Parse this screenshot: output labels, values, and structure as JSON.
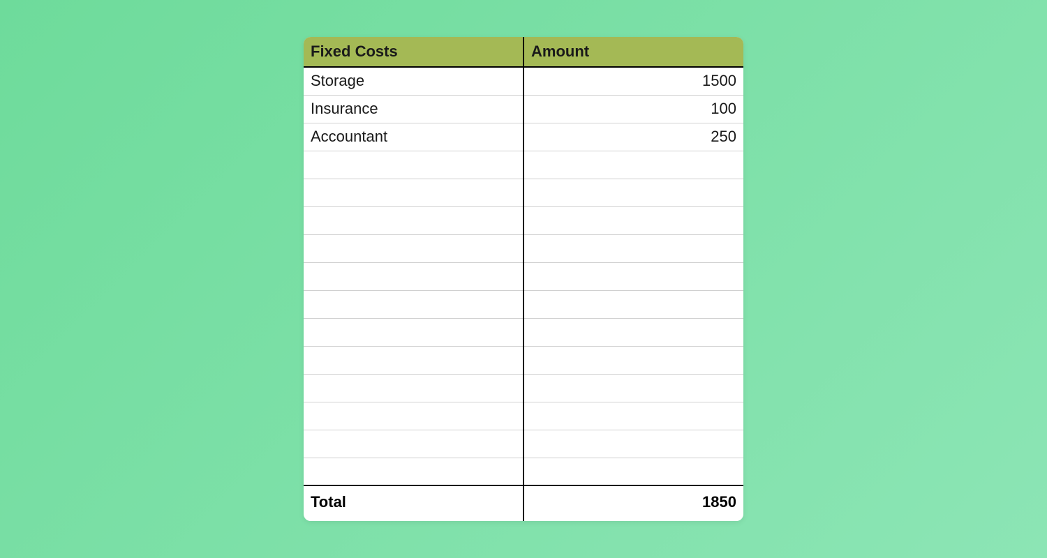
{
  "chart_data": {
    "type": "table",
    "title": "Fixed Costs",
    "columns": [
      "Fixed Costs",
      "Amount"
    ],
    "rows": [
      {
        "label": "Storage",
        "amount": 1500
      },
      {
        "label": "Insurance",
        "amount": 100
      },
      {
        "label": "Accountant",
        "amount": 250
      }
    ],
    "total_label": "Total",
    "total_amount": 1850
  },
  "table": {
    "header": {
      "col1": "Fixed Costs",
      "col2": "Amount"
    },
    "rows": [
      {
        "label": "Storage",
        "amount": "1500"
      },
      {
        "label": "Insurance",
        "amount": "100"
      },
      {
        "label": "Accountant",
        "amount": "250"
      },
      {
        "label": "",
        "amount": ""
      },
      {
        "label": "",
        "amount": ""
      },
      {
        "label": "",
        "amount": ""
      },
      {
        "label": "",
        "amount": ""
      },
      {
        "label": "",
        "amount": ""
      },
      {
        "label": "",
        "amount": ""
      },
      {
        "label": "",
        "amount": ""
      },
      {
        "label": "",
        "amount": ""
      },
      {
        "label": "",
        "amount": ""
      },
      {
        "label": "",
        "amount": ""
      },
      {
        "label": "",
        "amount": ""
      },
      {
        "label": "",
        "amount": ""
      }
    ],
    "footer": {
      "label": "Total",
      "amount": "1850"
    }
  },
  "colors": {
    "header_bg": "#a4b955",
    "border": "#000000",
    "row_border": "#d0d0d0",
    "page_bg_start": "#6edb9b",
    "page_bg_end": "#8ce5b5"
  }
}
